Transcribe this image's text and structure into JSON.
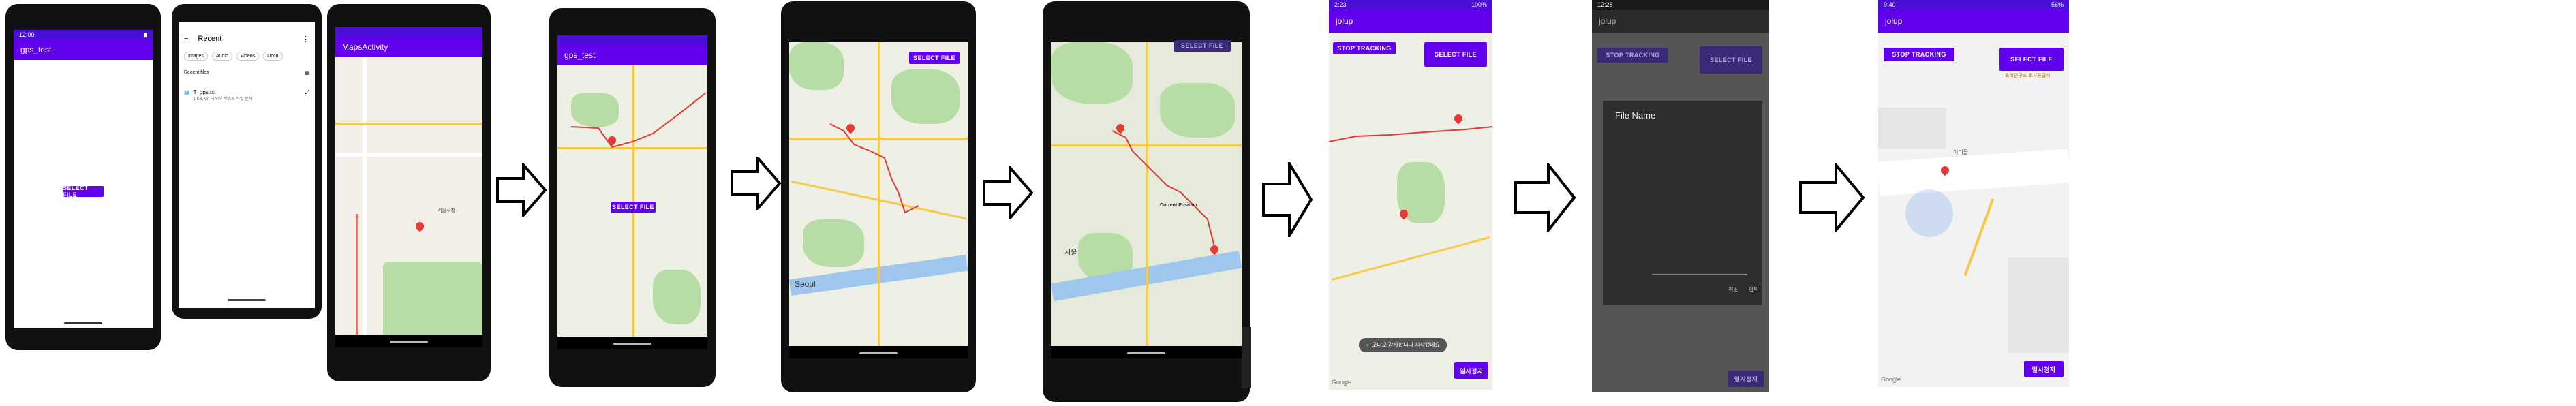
{
  "phones": {
    "p1": {
      "status": {
        "time": "12:00"
      },
      "title": "gps_test",
      "button": "SELECT FILE"
    },
    "p2": {
      "title": "Recent",
      "chips": [
        "Images",
        "Audio",
        "Videos",
        "Docu"
      ],
      "section": "Recent files",
      "file_name": "T_gps.txt",
      "file_meta": "1 KB, Wi-Fi 외부 텍스트 파일 문서"
    },
    "p3": {
      "title": "MapsActivity",
      "label": "서울시청"
    },
    "p4": {
      "title": "gps_test",
      "button": "SELECT FILE"
    },
    "p5": {
      "button": "SELECT FILE",
      "map_label": "Seoul"
    },
    "p6": {
      "button": "SELECT FILE",
      "pin_label": "Current Position",
      "river_label": "서울"
    },
    "p7": {
      "status": {
        "time": "2:23",
        "right": "100%"
      },
      "title": "jolup",
      "stop": "STOP TRACKING",
      "select": "SELECT FILE",
      "toast": "오디오 감사합니다 시작됐네요",
      "bottom_btn": "일시정지",
      "google": "Google"
    },
    "p8": {
      "status": {
        "time": "12:28"
      },
      "title": "jolup",
      "stop": "STOP TRACKING",
      "select": "SELECT FILE",
      "dialog_title": "File Name",
      "cancel": "취소",
      "confirm": "확인",
      "bottom_btn": "일시정지"
    },
    "p9": {
      "status": {
        "time": "9:40",
        "right": "56%"
      },
      "title": "jolup",
      "stop": "STOP TRACKING",
      "select": "SELECT FILE",
      "road_label": "이디몰",
      "marker_label": "특허연구소 토지공급지",
      "bottom_btn": "일시정지",
      "google": "Google"
    }
  },
  "colors": {
    "accent": "#6200ee",
    "status": "#4a0fd6",
    "route": "#e53935"
  }
}
